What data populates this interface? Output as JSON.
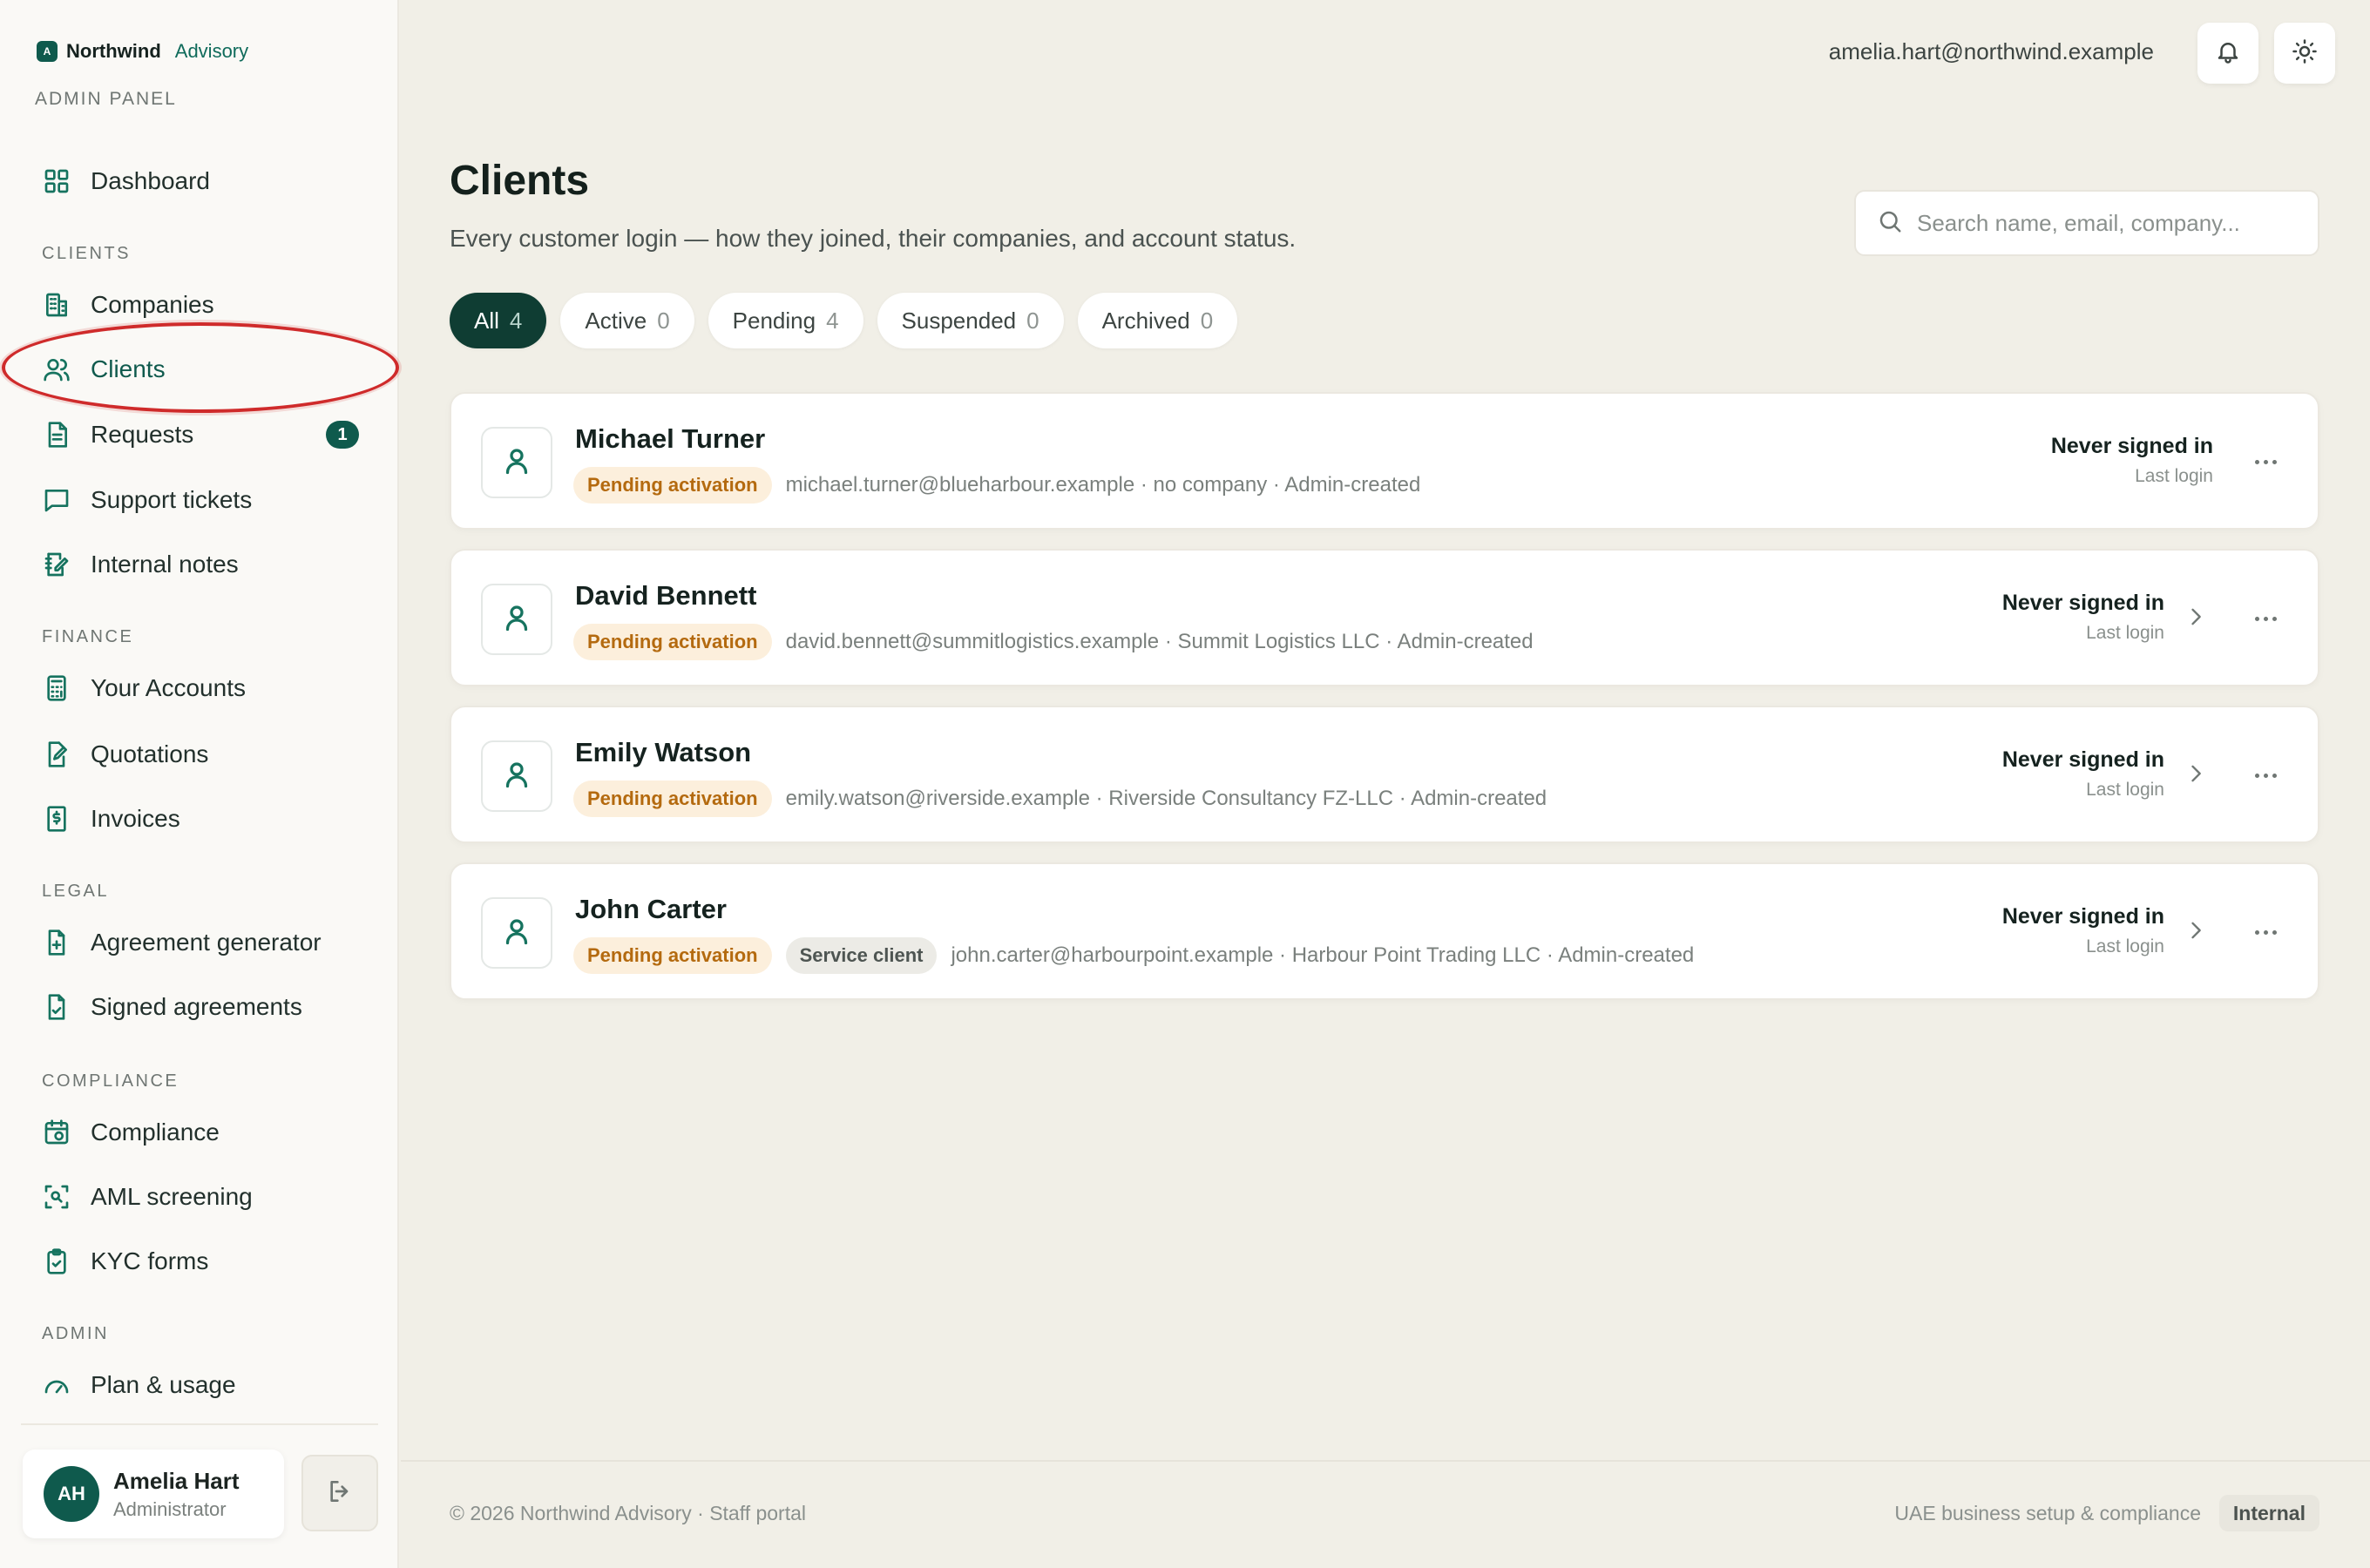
{
  "brand": {
    "mark": "A",
    "name": "Northwind",
    "sub": "Advisory",
    "panel": "ADMIN PANEL"
  },
  "nav": {
    "dashboard": "Dashboard",
    "clients_section": "CLIENTS",
    "companies": "Companies",
    "clients": "Clients",
    "requests": "Requests",
    "requests_badge": "1",
    "support": "Support tickets",
    "notes": "Internal notes",
    "finance_section": "FINANCE",
    "accounts": "Your Accounts",
    "quotations": "Quotations",
    "invoices": "Invoices",
    "legal_section": "LEGAL",
    "agreement_gen": "Agreement generator",
    "signed": "Signed agreements",
    "compliance_section": "COMPLIANCE",
    "compliance": "Compliance",
    "aml": "AML screening",
    "kyc": "KYC forms",
    "admin_section": "ADMIN",
    "plan": "Plan & usage",
    "icons": [
      "grid-icon",
      "building-icon",
      "users-icon",
      "document-icon",
      "chat-icon",
      "note-edit-icon",
      "calculator-icon",
      "file-edit-icon",
      "dollar-doc-icon",
      "file-plus-icon",
      "file-check-icon",
      "calendar-icon",
      "scan-icon",
      "clipboard-check-icon",
      "gauge-icon"
    ]
  },
  "user": {
    "initials": "AH",
    "name": "Amelia Hart",
    "role": "Administrator"
  },
  "header": {
    "email": "amelia.hart@northwind.example"
  },
  "page": {
    "title": "Clients",
    "subtitle": "Every customer login — how they joined, their companies, and account status.",
    "search_placeholder": "Search name, email, company..."
  },
  "tabs": [
    {
      "label": "All",
      "count": "4"
    },
    {
      "label": "Active",
      "count": "0"
    },
    {
      "label": "Pending",
      "count": "4"
    },
    {
      "label": "Suspended",
      "count": "0"
    },
    {
      "label": "Archived",
      "count": "0"
    }
  ],
  "clients": [
    {
      "name": "Michael Turner",
      "status": "Pending activation",
      "extra_badge": "",
      "meta": "michael.turner@blueharbour.example · no company · Admin-created",
      "login_status": "Never signed in",
      "login_label": "Last login",
      "chevron": false
    },
    {
      "name": "David Bennett",
      "status": "Pending activation",
      "extra_badge": "",
      "meta": "david.bennett@summitlogistics.example · Summit Logistics LLC · Admin-created",
      "login_status": "Never signed in",
      "login_label": "Last login",
      "chevron": true
    },
    {
      "name": "Emily Watson",
      "status": "Pending activation",
      "extra_badge": "",
      "meta": "emily.watson@riverside.example · Riverside Consultancy FZ-LLC · Admin-created",
      "login_status": "Never signed in",
      "login_label": "Last login",
      "chevron": true
    },
    {
      "name": "John Carter",
      "status": "Pending activation",
      "extra_badge": "Service client",
      "meta": "john.carter@harbourpoint.example · Harbour Point Trading LLC · Admin-created",
      "login_status": "Never signed in",
      "login_label": "Last login",
      "chevron": true
    }
  ],
  "footer": {
    "left": "© 2026 Northwind Advisory · Staff portal",
    "right": "UAE business setup & compliance",
    "pill": "Internal"
  },
  "colors": {
    "accent": "#0f5a4d",
    "highlight": "#cf2b2b",
    "pending_bg": "#fcefdc",
    "pending_text": "#b46a0f"
  }
}
